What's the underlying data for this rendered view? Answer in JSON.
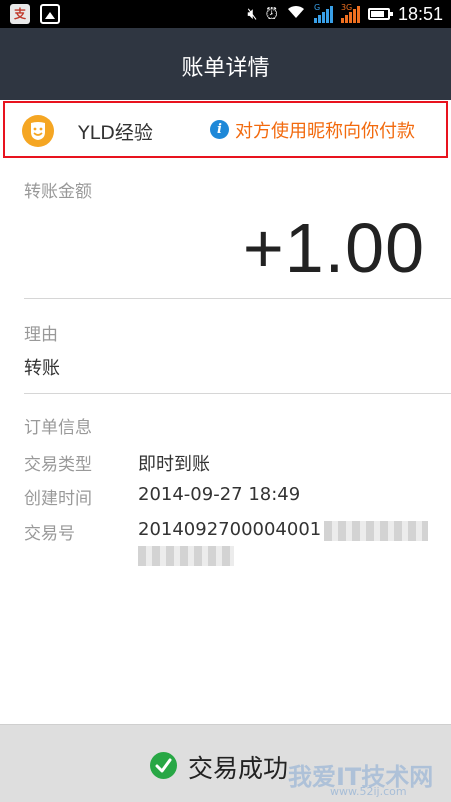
{
  "status_bar": {
    "app_icon_1": "支",
    "network_1": "G",
    "network_2": "3G",
    "time": "18:51"
  },
  "header": {
    "title": "账单详情"
  },
  "payer": {
    "name": "YLD经验",
    "note": "对方使用昵称向你付款"
  },
  "amount": {
    "label": "转账金额",
    "value": "+1.00"
  },
  "reason": {
    "label": "理由",
    "value": "转账"
  },
  "order": {
    "section_label": "订单信息",
    "rows": [
      {
        "label": "交易类型",
        "value": "即时到账"
      },
      {
        "label": "创建时间",
        "value": "2014-09-27 18:49"
      },
      {
        "label": "交易号",
        "value": "2014092700004001"
      }
    ]
  },
  "footer": {
    "status": "交易成功",
    "watermark": "我爱IT技术网",
    "watermark_url": "www.52ij.com"
  },
  "colors": {
    "header_bg": "#2f3641",
    "accent_orange": "#f26a0e",
    "highlight_border": "#e8131e",
    "success_green": "#28a745"
  }
}
